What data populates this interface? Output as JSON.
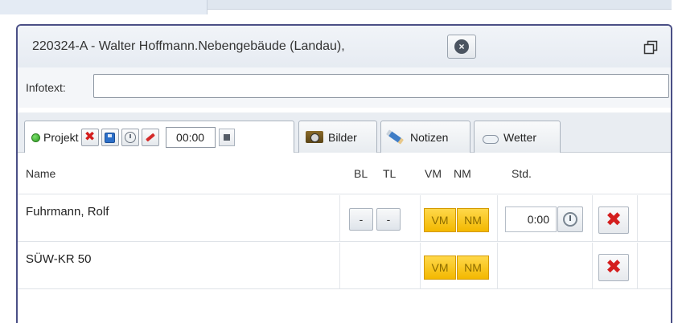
{
  "window": {
    "title": "220324-A - Walter Hoffmann.Nebengebäude (Landau),",
    "close_icon": "close-icon",
    "restore_icon": "restore-window-icon"
  },
  "info": {
    "label": "Infotext:",
    "value": ""
  },
  "tabs": {
    "projekt": {
      "label": "Projekt",
      "time": "00:00"
    },
    "bilder": {
      "label": "Bilder"
    },
    "notizen": {
      "label": "Notizen"
    },
    "wetter": {
      "label": "Wetter"
    }
  },
  "grid": {
    "headers": {
      "name": "Name",
      "bl": "BL",
      "tl": "TL",
      "vm": "VM",
      "nm": "NM",
      "std": "Std."
    },
    "rows": [
      {
        "name": "Fuhrmann, Rolf",
        "bl": "-",
        "tl": "-",
        "vm": "VM",
        "nm": "NM",
        "std": "0:00"
      },
      {
        "name": "SÜW-KR 50",
        "vm": "VM",
        "nm": "NM"
      }
    ]
  },
  "colors": {
    "accent_border": "#4a4f86",
    "yellow": "#f3b800",
    "delete_red": "#d41e1e"
  }
}
